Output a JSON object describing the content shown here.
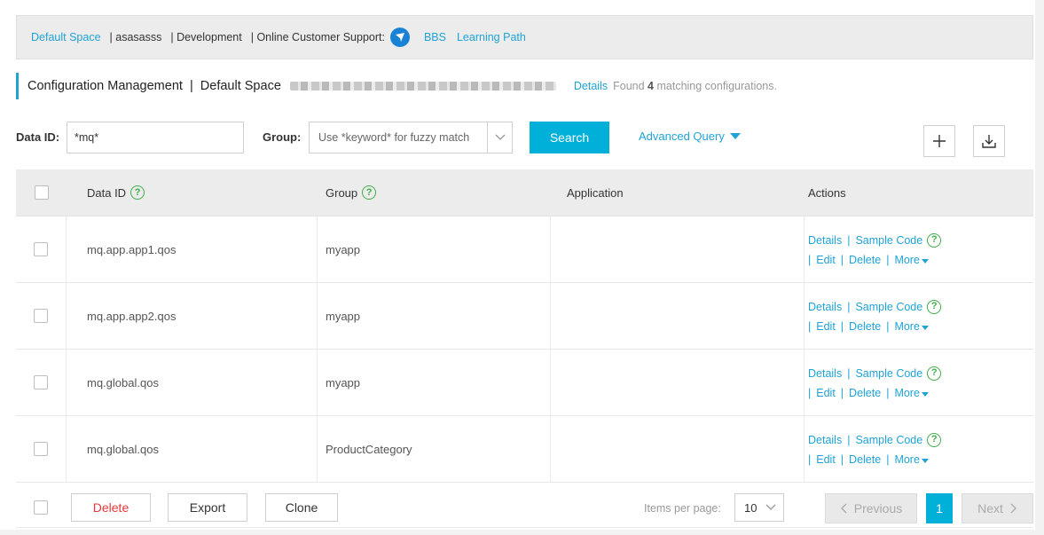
{
  "topbar": {
    "space": "Default Space",
    "user": "| asasasss",
    "env": "| Development",
    "support_label": "| Online Customer Support:",
    "support_icon": "support-bird-icon",
    "bbs": "BBS",
    "learning": "Learning Path"
  },
  "titlebar": {
    "title": "Configuration Management  |  Default Space",
    "details": "Details",
    "found_prefix": "Found",
    "found_count": "4",
    "found_suffix": "matching configurations."
  },
  "filter": {
    "data_id_label": "Data ID:",
    "data_id_value": "*mq*",
    "group_label": "Group:",
    "group_placeholder": "Use *keyword* for fuzzy match",
    "search": "Search",
    "advanced": "Advanced Query",
    "add_icon": "plus-icon",
    "import_icon": "download-icon"
  },
  "table": {
    "headers": {
      "data_id": "Data ID",
      "group": "Group",
      "application": "Application",
      "actions": "Actions"
    },
    "actions": {
      "details": "Details",
      "sample_code": "Sample Code",
      "edit": "Edit",
      "delete": "Delete",
      "more": "More"
    },
    "rows": [
      {
        "data_id": "mq.app.app1.qos",
        "group": "myapp",
        "application": ""
      },
      {
        "data_id": "mq.app.app2.qos",
        "group": "myapp",
        "application": ""
      },
      {
        "data_id": "mq.global.qos",
        "group": "myapp",
        "application": ""
      },
      {
        "data_id": "mq.global.qos",
        "group": "ProductCategory",
        "application": ""
      }
    ]
  },
  "footer": {
    "delete": "Delete",
    "export": "Export",
    "clone": "Clone",
    "per_page_label": "Items per page:",
    "per_page_value": "10",
    "previous": "Previous",
    "page": "1",
    "next": "Next"
  },
  "colors": {
    "accent": "#00b0d8",
    "link": "#1fa3d6",
    "danger": "#e4393c",
    "help": "#3fae49"
  }
}
